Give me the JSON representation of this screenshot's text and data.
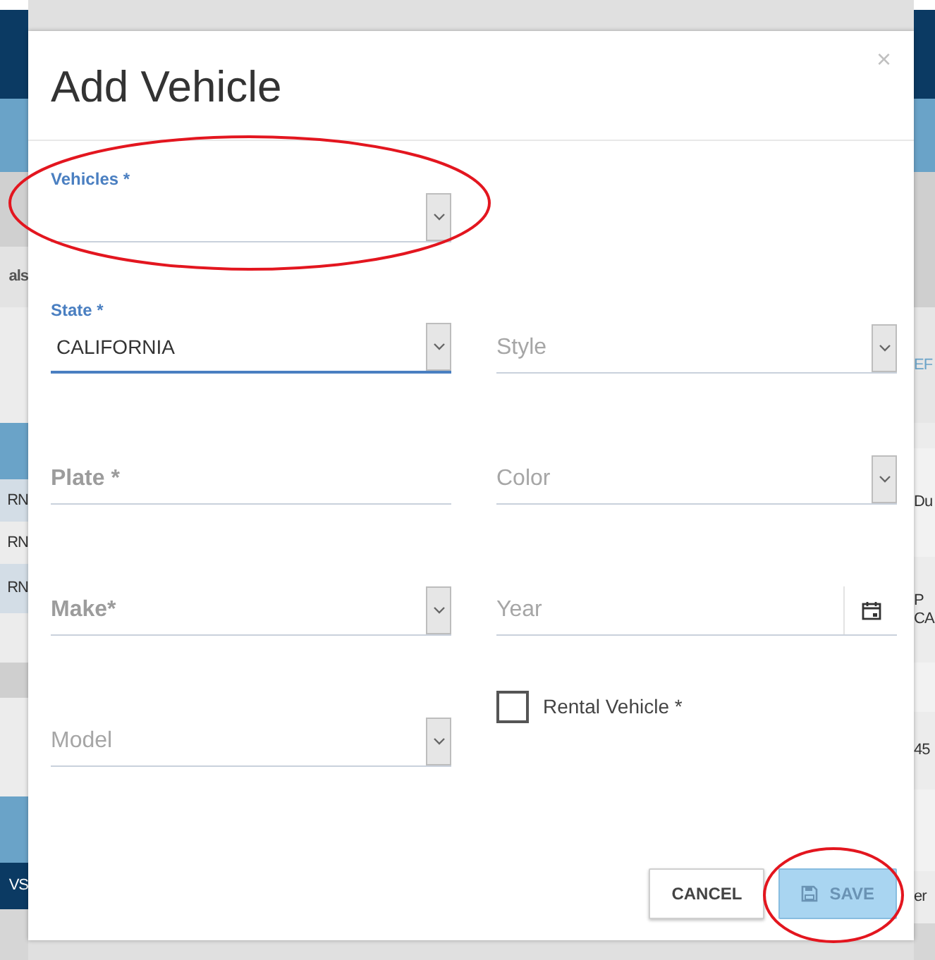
{
  "background": {
    "left_fragments": [
      "als",
      "RN",
      "RN",
      "RN",
      "VS"
    ],
    "right_fragments": [
      "EF",
      "Du",
      "P",
      "CA",
      "45",
      "er"
    ]
  },
  "dialog": {
    "title": "Add Vehicle",
    "close": "×",
    "rows": [
      [
        {
          "kind": "select",
          "label": "Vehicles *",
          "focused": false
        }
      ],
      [
        {
          "kind": "select",
          "label": "State *",
          "value": "CALIFORNIA",
          "focused": true
        },
        {
          "kind": "select",
          "placeholder": "Style",
          "emphasis": false,
          "focused": false
        }
      ],
      [
        {
          "kind": "text",
          "placeholder": "Plate *",
          "emphasis": true,
          "focused": false
        },
        {
          "kind": "select",
          "placeholder": "Color",
          "emphasis": false,
          "focused": false
        }
      ],
      [
        {
          "kind": "select",
          "placeholder": "Make*",
          "emphasis": true,
          "focused": false
        },
        {
          "kind": "date",
          "placeholder": "Year",
          "emphasis": false,
          "focused": false
        }
      ],
      [
        {
          "kind": "select",
          "placeholder": "Model",
          "emphasis": false,
          "focused": false
        },
        {
          "kind": "checkbox",
          "label": "Rental Vehicle *",
          "checked": false
        }
      ]
    ],
    "buttons": [
      {
        "kind": "secondary",
        "label": "CANCEL",
        "disabled": false
      },
      {
        "kind": "primary",
        "label": "SAVE",
        "disabled": true
      }
    ]
  }
}
